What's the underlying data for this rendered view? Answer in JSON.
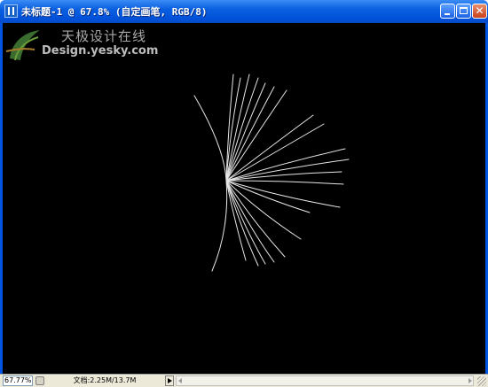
{
  "window": {
    "title": "未标题-1 @ 67.8% (自定画笔, RGB/8)",
    "icon": "document-icon",
    "controls": [
      "minimize",
      "maximize",
      "close"
    ]
  },
  "watermark": {
    "chinese": "天极设计在线",
    "english": "Design.yesky.com"
  },
  "canvas": {
    "background": "#000000",
    "content": "white brush strokes fanning from a single point"
  },
  "status_bar": {
    "zoom": "67.77%",
    "doc_info": "文档:2.25M/13.7M"
  },
  "colors": {
    "titlebar": "#0054e3",
    "canvas": "#000000",
    "stroke": "#e6e6e6",
    "statusbar": "#ece9d8"
  }
}
